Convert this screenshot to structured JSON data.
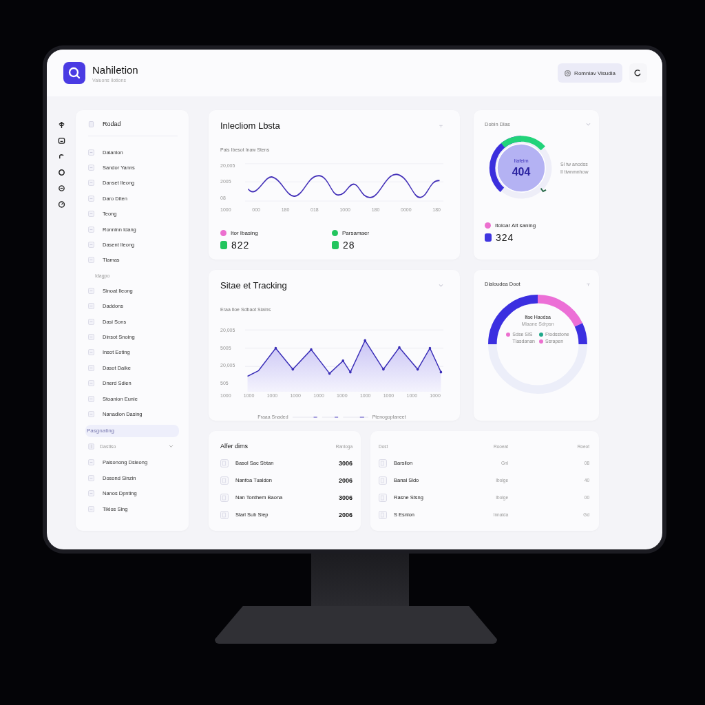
{
  "header": {
    "title": "Nahiletion",
    "subtitle": "Vaiuons Ilotions",
    "button": "Romniav Visudia"
  },
  "sidebar": {
    "heading": "Rodad",
    "items": [
      {
        "kind": "item",
        "label": "Dalanlon",
        "selected": false
      },
      {
        "kind": "item",
        "label": "Sandor Yanns",
        "selected": false
      },
      {
        "kind": "item",
        "label": "Danset Ileong",
        "selected": false
      },
      {
        "kind": "item",
        "label": "Daro Diten",
        "selected": false
      },
      {
        "kind": "item",
        "label": "Teong",
        "selected": false
      },
      {
        "kind": "item",
        "label": "Ronninn Idang",
        "selected": false
      },
      {
        "kind": "item",
        "label": "Dasent Ileong",
        "selected": false
      },
      {
        "kind": "item",
        "label": "Tlamas",
        "selected": false
      },
      {
        "kind": "section",
        "label": "Idagpo"
      },
      {
        "kind": "item",
        "label": "Sinoat Ileong",
        "selected": false
      },
      {
        "kind": "item",
        "label": "Daddons",
        "selected": false
      },
      {
        "kind": "item",
        "label": "Dasi Sons",
        "selected": false
      },
      {
        "kind": "item",
        "label": "Dinsot Snoing",
        "selected": false
      },
      {
        "kind": "item",
        "label": "Insot Eoting",
        "selected": false
      },
      {
        "kind": "item",
        "label": "Dasot Daike",
        "selected": false
      },
      {
        "kind": "item",
        "label": "Dnerd Sdien",
        "selected": false
      },
      {
        "kind": "item",
        "label": "Stoanion Eunie",
        "selected": false
      },
      {
        "kind": "item",
        "label": "Nanadlon Dasing",
        "selected": false
      },
      {
        "kind": "section",
        "label": "Pasgnating",
        "selected": true
      },
      {
        "kind": "group",
        "label": "Dastiso"
      },
      {
        "kind": "item",
        "label": "Paisonong Dsleong",
        "selected": false
      },
      {
        "kind": "item",
        "label": "Dosond Sinzin",
        "selected": false
      },
      {
        "kind": "item",
        "label": "Nanos Dpnting",
        "selected": false
      },
      {
        "kind": "item",
        "label": "Tiklos Sing",
        "selected": false
      }
    ]
  },
  "line_card": {
    "title": "Inlecliom Lbsta",
    "subtitle": "Pais Ibesot Inaw Stens",
    "y_labels": [
      "20,005",
      "2005",
      "08"
    ],
    "x_labels": [
      "1000",
      "000",
      "180",
      "018",
      "1000",
      "180",
      "0000",
      "180"
    ],
    "stats": [
      {
        "label": "Itor Ibasing",
        "color": "#ec6fcf",
        "value": "822",
        "badge": {
          "color": "#22c55e"
        }
      },
      {
        "label": "Parsamaer",
        "color": "#22c55e",
        "value": "28",
        "badge": {
          "color": "#22c55e"
        }
      }
    ]
  },
  "gauge_card": {
    "title": "Dobin Dlas",
    "center_label": "Itafeim",
    "center_value": "404",
    "legend": [
      "Sl tw anodss",
      "Il tiwnmnhow"
    ],
    "stats": [
      {
        "label": "Itoloar Alt saning",
        "color": "#ec6fcf",
        "value": "324",
        "badge": {
          "color": "#3f35e0"
        }
      }
    ]
  },
  "area_card": {
    "title": "Sitae et Tracking",
    "subtitle": "Eraa Iloe Sdbaot Siains",
    "y_labels": [
      "20,005",
      "5005",
      "20,005",
      "505"
    ],
    "x_labels": [
      "1000",
      "1000",
      "1000",
      "1000",
      "1000",
      "1000",
      "1000",
      "1000",
      "1000",
      "1000"
    ],
    "legend": [
      "Fraaa Snaded",
      "Ptenogoplaneet"
    ]
  },
  "donut_card": {
    "title": "Dlaloudea Doot",
    "center_title": "Ifae Haodsa",
    "center_subtitle": "Mlaane Sdrpsn",
    "legend": [
      {
        "label": "Sdse SIS",
        "color": "#ec6fcf"
      },
      {
        "label": "Ftodsstone",
        "color": "#1fa88a"
      },
      {
        "label": "Tlasdanan"
      },
      {
        "label": "Ssrapen",
        "color": "#ec6fcf"
      }
    ]
  },
  "table_left": {
    "columns": [
      "Alfer dims",
      "Ranloga"
    ],
    "rows": [
      {
        "name": "Basol Sac Sbtan",
        "value": "3006"
      },
      {
        "name": "Nanfoa Tualdon",
        "value": "2006"
      },
      {
        "name": "Nan Tonthem Baona",
        "value": "3006"
      },
      {
        "name": "Slarl Sub Slep",
        "value": "2006"
      }
    ]
  },
  "table_right": {
    "columns": [
      "Dost",
      "Rooeat",
      "Roeot"
    ],
    "rows": [
      {
        "name": "Barsilon",
        "col2": "Gnl",
        "col3": "08"
      },
      {
        "name": "Banal Sldo",
        "col2": "Ibolge",
        "col3": "40"
      },
      {
        "name": "Rasne Stsng",
        "col2": "Ibolge",
        "col3": "00"
      },
      {
        "name": "S Esnlon",
        "col2": "Innaida",
        "col3": "Gd"
      }
    ]
  }
}
